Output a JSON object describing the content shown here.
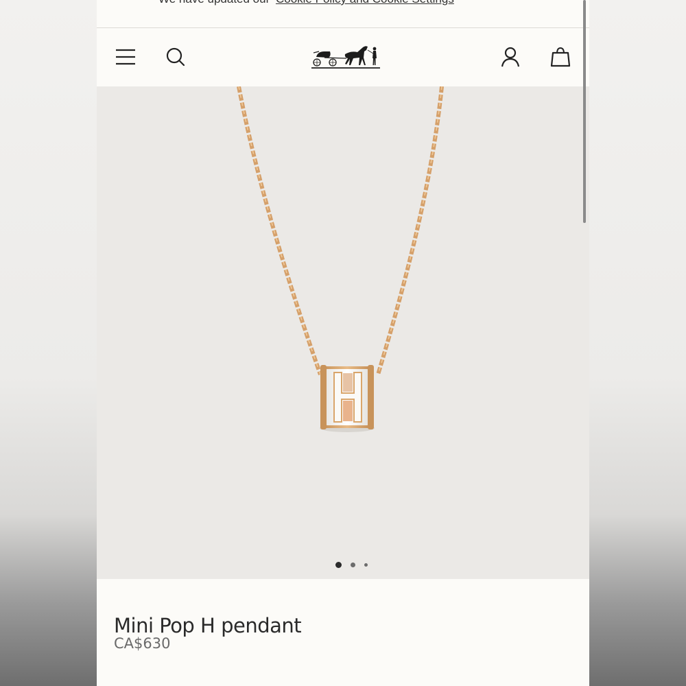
{
  "notice": {
    "text": "We have updated our",
    "link": "Cookie Policy and Cookie Settings"
  },
  "header": {
    "menu_icon": "hamburger-menu-icon",
    "search_icon": "search-icon",
    "logo": "hermes-carriage-logo",
    "account_icon": "user-account-icon",
    "bag_icon": "shopping-bag-icon"
  },
  "carousel": {
    "slide_count": 3,
    "active_index": 0
  },
  "product": {
    "name": "Mini Pop H pendant",
    "price": "CA$630"
  },
  "colors": {
    "background": "#fcfbf8",
    "hero_background": "#ebe9e6",
    "gold": "#d9a56a",
    "enamel_white": "#f7f6f3"
  }
}
